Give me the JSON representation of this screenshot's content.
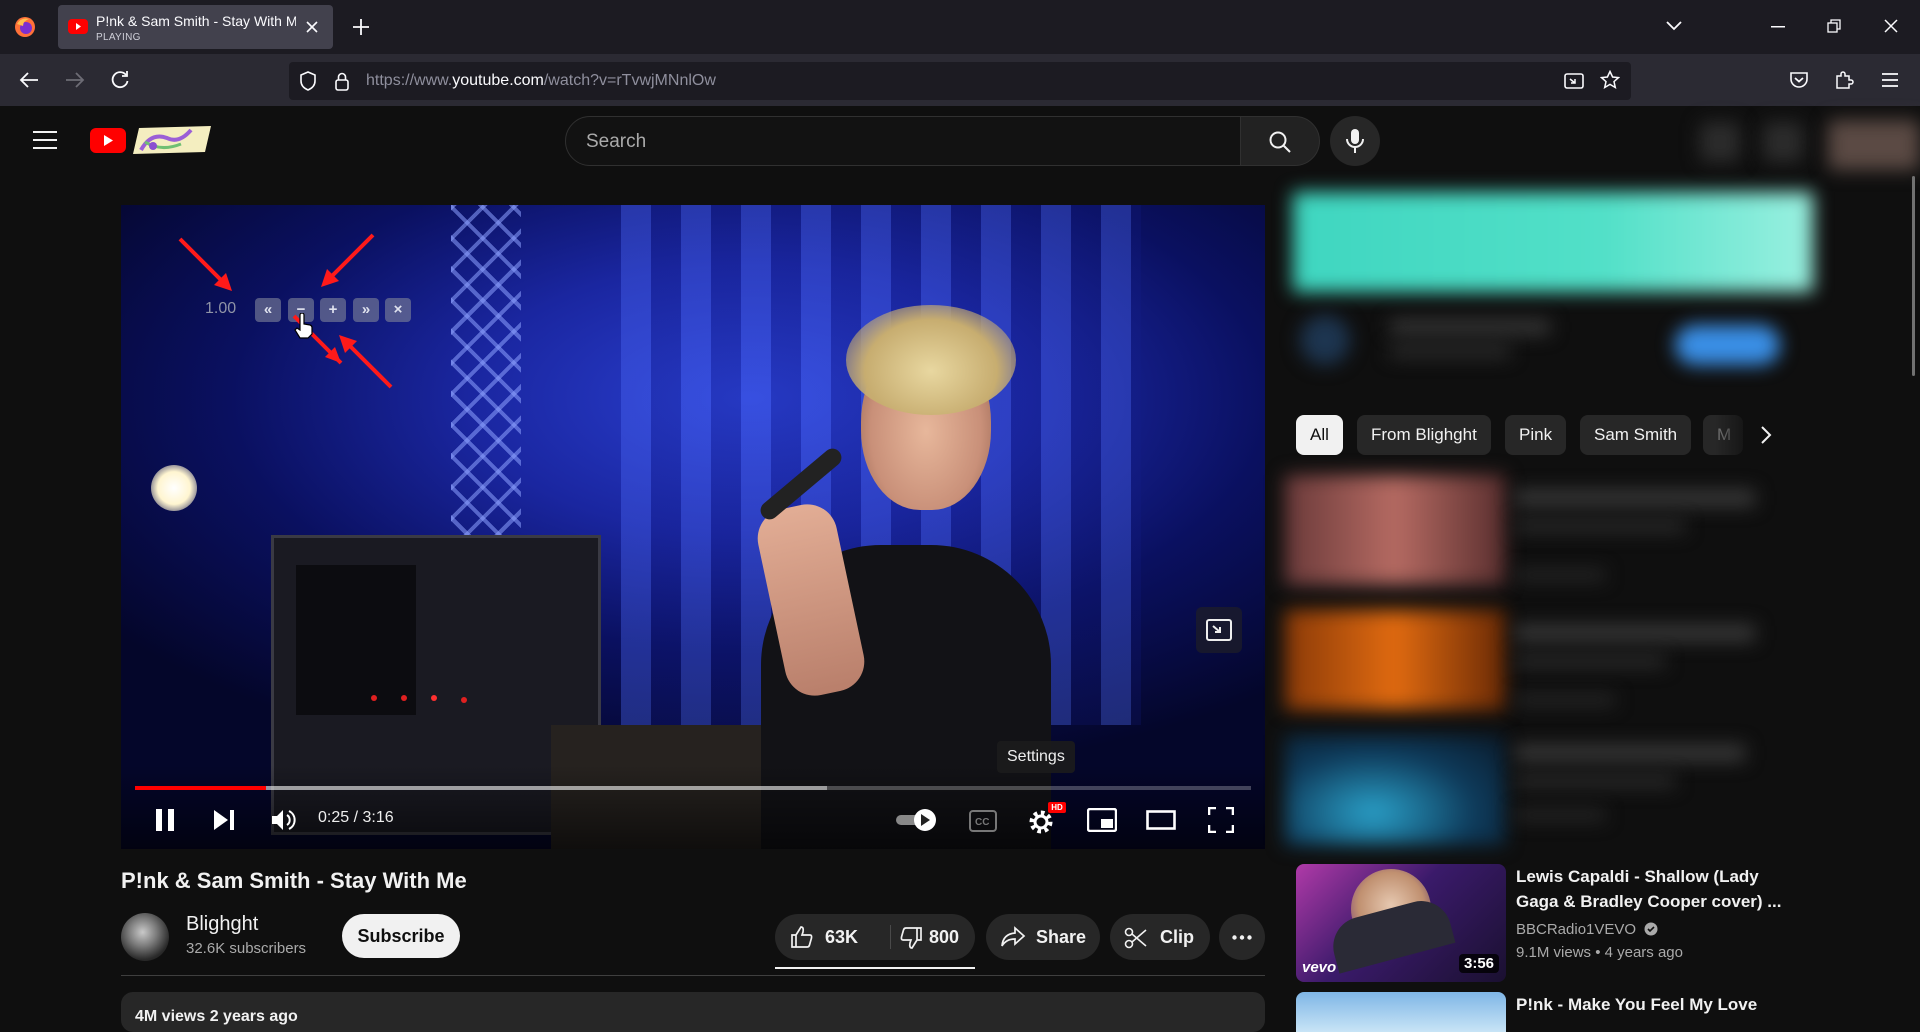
{
  "browser": {
    "tab": {
      "title": "P!nk & Sam Smith - Stay With Me",
      "status": "PLAYING"
    },
    "url": {
      "prefix": "https://www.",
      "domain": "youtube.com",
      "path": "/watch?v=rTvwjMNnlOw"
    }
  },
  "youtube": {
    "search_placeholder": "Search"
  },
  "player": {
    "speed_value": "1.00",
    "speed_buttons": {
      "slower_more": "«",
      "slower": "−",
      "faster": "+",
      "faster_more": "»",
      "close": "×"
    },
    "time": "0:25 / 3:16",
    "progress_played": 0.117,
    "progress_buffered": 0.62,
    "tooltip": "Settings",
    "hd_badge": "HD"
  },
  "video": {
    "title": "P!nk & Sam Smith - Stay With Me",
    "channel": "Blighght",
    "subscribers": "32.6K subscribers",
    "subscribe_label": "Subscribe",
    "likes": "63K",
    "dislikes": "800",
    "share_label": "Share",
    "clip_label": "Clip",
    "description_preview": "4M views  2 years ago"
  },
  "sidebar": {
    "chips": [
      "All",
      "From Blighght",
      "Pink",
      "Sam Smith",
      "M"
    ],
    "recommendations": [
      {
        "title": "Lewis Capaldi - Shallow (Lady Gaga & Bradley Cooper cover) ...",
        "channel": "BBCRadio1VEVO",
        "meta": "9.1M views • 4 years ago",
        "duration": "3:56",
        "badge": "vevo"
      },
      {
        "title": "P!nk - Make You Feel My Love"
      }
    ]
  }
}
